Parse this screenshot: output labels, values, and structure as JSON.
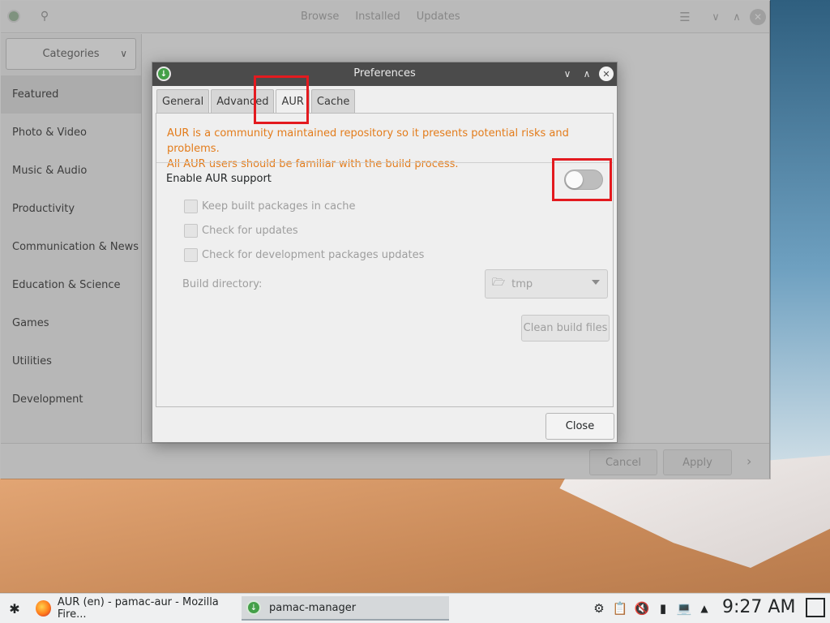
{
  "main_window": {
    "header": {
      "tabs": [
        "Browse",
        "Installed",
        "Updates"
      ]
    },
    "sidebar": {
      "categories_label": "Categories",
      "items": [
        {
          "label": "Featured",
          "active": true
        },
        {
          "label": "Photo & Video"
        },
        {
          "label": "Music & Audio"
        },
        {
          "label": "Productivity"
        },
        {
          "label": "Communication & News"
        },
        {
          "label": "Education & Science"
        },
        {
          "label": "Games"
        },
        {
          "label": "Utilities"
        },
        {
          "label": "Development"
        }
      ]
    },
    "footer": {
      "cancel_label": "Cancel",
      "apply_label": "Apply"
    }
  },
  "dialog": {
    "title": "Preferences",
    "tabs": [
      "General",
      "Advanced",
      "AUR",
      "Cache"
    ],
    "active_tab": "AUR",
    "warning_line1": "AUR is a community maintained repository so it presents potential risks and problems.",
    "warning_line2": "All AUR users should be familiar with the build process.",
    "enable_label": "Enable AUR support",
    "enable_on": false,
    "options": [
      {
        "label": "Keep built packages in cache",
        "checked": false
      },
      {
        "label": "Check for updates",
        "checked": false
      },
      {
        "label": "Check for development packages updates",
        "checked": false
      }
    ],
    "build_dir_label": "Build directory:",
    "build_dir_value": "tmp",
    "clean_label": "Clean build files",
    "close_label": "Close"
  },
  "taskbar": {
    "tasks": [
      {
        "label": "AUR (en) - pamac-aur - Mozilla Fire...",
        "icon": "firefox-icon"
      },
      {
        "label": "pamac-manager",
        "icon": "pamac-icon",
        "active": true
      }
    ],
    "clock": "9:27 AM"
  },
  "colors": {
    "warning": "#e37c1b",
    "annotation": "#e31a1f",
    "titlebar": "#4b4b4b"
  }
}
